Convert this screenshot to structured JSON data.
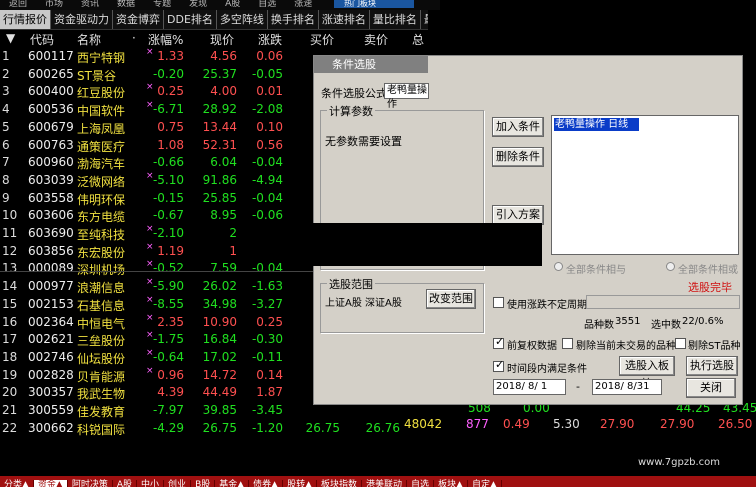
{
  "menubar": [
    "返回",
    "市场",
    "资讯",
    "数据",
    "专题",
    "发现",
    "A股",
    "自选",
    "涨速"
  ],
  "corner_tab": "热门板块",
  "tabs": [
    "行情报价",
    "资金驱动力",
    "资金博弈",
    "DDE排名",
    "多空阵线",
    "换手排名",
    "涨速排名",
    "量比排名",
    "最近浏览"
  ],
  "header": {
    "idx": "▼",
    "code": "代码",
    "name": "名称",
    "mark": "·",
    "pct": "涨幅%",
    "price": "现价",
    "chg": "涨跌",
    "buy": "买价",
    "sell": "卖价",
    "total": "总"
  },
  "rows": [
    {
      "idx": "1",
      "code": "600117",
      "name": "西宁特钢",
      "mark": "×",
      "pct": "1.33",
      "price": "4.56",
      "chg": "0.06",
      "dir": "up"
    },
    {
      "idx": "2",
      "code": "600265",
      "name": "ST景谷",
      "mark": "",
      "pct": "-0.20",
      "price": "25.37",
      "chg": "-0.05",
      "dir": "down"
    },
    {
      "idx": "3",
      "code": "600400",
      "name": "红豆股份",
      "mark": "×",
      "pct": "0.25",
      "price": "4.00",
      "chg": "0.01",
      "dir": "up"
    },
    {
      "idx": "4",
      "code": "600536",
      "name": "中国软件",
      "mark": "×",
      "pct": "-6.71",
      "price": "28.92",
      "chg": "-2.08",
      "dir": "down"
    },
    {
      "idx": "5",
      "code": "600679",
      "name": "上海凤凰",
      "mark": "",
      "pct": "0.75",
      "price": "13.44",
      "chg": "0.10",
      "dir": "up"
    },
    {
      "idx": "6",
      "code": "600763",
      "name": "通策医疗",
      "mark": "",
      "pct": "1.08",
      "price": "52.31",
      "chg": "0.56",
      "dir": "up"
    },
    {
      "idx": "7",
      "code": "600960",
      "name": "渤海汽车",
      "mark": "",
      "pct": "-0.66",
      "price": "6.04",
      "chg": "-0.04",
      "dir": "down"
    },
    {
      "idx": "8",
      "code": "603039",
      "name": "泛微网络",
      "mark": "×",
      "pct": "-5.10",
      "price": "91.86",
      "chg": "-4.94",
      "dir": "down"
    },
    {
      "idx": "9",
      "code": "603558",
      "name": "伟明环保",
      "mark": "",
      "pct": "-0.15",
      "price": "25.85",
      "chg": "-0.04",
      "dir": "down"
    },
    {
      "idx": "10",
      "code": "603606",
      "name": "东方电缆",
      "mark": "",
      "pct": "-0.67",
      "price": "8.95",
      "chg": "-0.06",
      "dir": "down"
    },
    {
      "idx": "11",
      "code": "603690",
      "name": "至纯科技",
      "mark": "×",
      "pct": "-2.10",
      "price": "2",
      "chg": "",
      "dir": "down"
    },
    {
      "idx": "12",
      "code": "603856",
      "name": "东宏股份",
      "mark": "×",
      "pct": "1.19",
      "price": "1",
      "chg": "",
      "dir": "up"
    },
    {
      "idx": "13",
      "code": "000089",
      "name": "深圳机场",
      "mark": "×",
      "pct": "-0.52",
      "price": "7.59",
      "chg": "-0.04",
      "dir": "down"
    },
    {
      "idx": "14",
      "code": "000977",
      "name": "浪潮信息",
      "mark": "×",
      "pct": "-5.90",
      "price": "26.02",
      "chg": "-1.63",
      "dir": "down"
    },
    {
      "idx": "15",
      "code": "002153",
      "name": "石基信息",
      "mark": "×",
      "pct": "-8.55",
      "price": "34.98",
      "chg": "-3.27",
      "dir": "down"
    },
    {
      "idx": "16",
      "code": "002364",
      "name": "中恒电气",
      "mark": "×",
      "pct": "2.35",
      "price": "10.90",
      "chg": "0.25",
      "dir": "up"
    },
    {
      "idx": "17",
      "code": "002621",
      "name": "三垒股份",
      "mark": "×",
      "pct": "-1.75",
      "price": "16.84",
      "chg": "-0.30",
      "dir": "down"
    },
    {
      "idx": "18",
      "code": "002746",
      "name": "仙坛股份",
      "mark": "×",
      "pct": "-0.64",
      "price": "17.02",
      "chg": "-0.11",
      "dir": "down"
    },
    {
      "idx": "19",
      "code": "002828",
      "name": "贝肯能源",
      "mark": "×",
      "pct": "0.96",
      "price": "14.72",
      "chg": "0.14",
      "dir": "up"
    },
    {
      "idx": "20",
      "code": "300357",
      "name": "我武生物",
      "mark": "",
      "pct": "4.39",
      "price": "44.49",
      "chg": "1.87",
      "dir": "up"
    },
    {
      "idx": "21",
      "code": "300559",
      "name": "佳发教育",
      "mark": "",
      "pct": "-7.97",
      "price": "39.85",
      "chg": "-3.45",
      "dir": "down"
    },
    {
      "idx": "22",
      "code": "300662",
      "name": "科锐国际",
      "mark": "",
      "pct": "-4.29",
      "price": "26.75",
      "chg": "-1.20",
      "buy": "26.75",
      "sell": "26.76",
      "dir": "down"
    }
  ],
  "row21_right": [
    "508",
    "0.00",
    "44.25",
    "43.45"
  ],
  "row22_right": [
    "48042",
    "877",
    "0.49",
    "5.30",
    "27.90",
    "27.90",
    "26.50"
  ],
  "dialog": {
    "title": "条件选股",
    "formula_label": "条件选股公式",
    "formula_value": "老鸭量操作",
    "params_group": "计算参数",
    "params_text": "无参数需要设置",
    "add_btn": "加入条件",
    "del_btn": "删除条件",
    "import_btn": "引入方案",
    "condition_item": "老鸭量操作  日线",
    "radio_and": "全部条件相与",
    "radio_or": "全部条件相或",
    "done": "选股完毕",
    "range_group": "选股范围",
    "range_text": "上证A股 深证A股",
    "range_btn": "改变范围",
    "use_chg_label": "使用涨跌不定周期",
    "count_label": "品种数",
    "count_value": "3551",
    "selected_label": "选中数",
    "selected_value": "22/0.6%",
    "prev_adj_label": "前复权数据",
    "exclude_inactive_label": "剔除当前未交易的品种",
    "exclude_st_label": "剔除ST品种",
    "period_label": "时间段内满足条件",
    "to_board_btn": "选股入板块",
    "exec_btn": "执行选股",
    "date_from": "2018/ 8/ 1",
    "date_sep": "-",
    "date_to": "2018/ 8/31",
    "close_btn": "关闭"
  },
  "bottombar": [
    "分类▲",
    "资金▲",
    "阿时决策",
    "A股",
    "中小",
    "创业",
    "B股",
    "基金▲",
    "债券▲",
    "股转▲",
    "板块指数",
    "港美联动",
    "自选",
    "板块▲",
    "自定▲"
  ],
  "watermark": "www.7gpzb.com",
  "colors": {
    "up": "#ff5050",
    "down": "#20e020",
    "name": "#f0e040",
    "accent": "#a01010"
  }
}
